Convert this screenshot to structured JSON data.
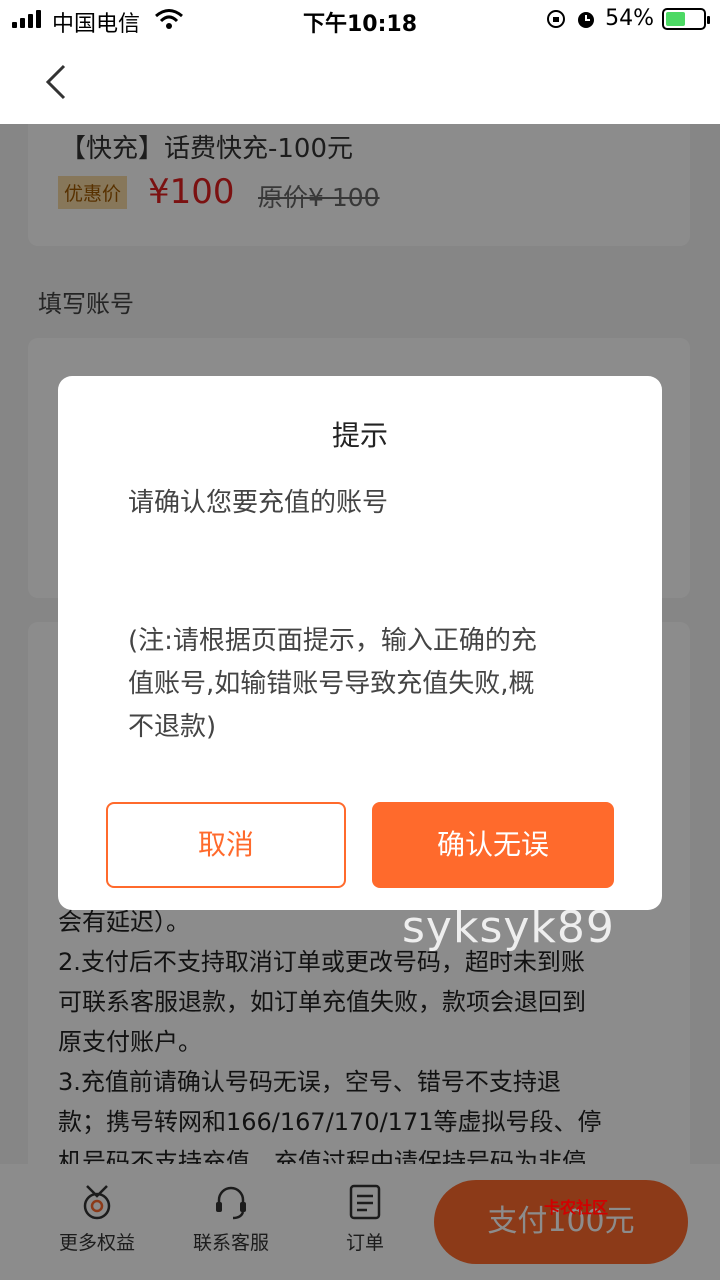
{
  "status_bar": {
    "carrier": "中国电信",
    "time": "下午10:18",
    "battery": "54%",
    "battery_level": 0.54
  },
  "product": {
    "title": "【快充】话费快充-100元",
    "tag": "优惠价",
    "price": "¥100",
    "original_price": "原价¥ 100"
  },
  "account_section": {
    "label": "填写账号"
  },
  "notes": [
    "会有延迟）。",
    "2.支付后不支持取消订单或更改号码，超时未到账",
    "可联系客服退款，如订单充值失败，款项会退回到",
    "原支付账户。",
    "3.充值前请确认号码无误，空号、错号不支持退",
    "款；携号转网和166/167/170/171等虚拟号段、停",
    "机号码不支持充值，充值过程中请保持号码为非停"
  ],
  "dialog": {
    "title": "提示",
    "message": "请确认您要充值的账号",
    "note_lines": [
      "(注:请根据页面提示，输入正确的充",
      "值账号,如输错账号导致充值失败,概",
      "不退款)"
    ],
    "cancel_label": "取消",
    "confirm_label": "确认无误"
  },
  "bottom_bar": {
    "tabs": [
      {
        "label": "更多权益",
        "icon": "medal-icon"
      },
      {
        "label": "联系客服",
        "icon": "headset-icon"
      },
      {
        "label": "订单",
        "icon": "order-list-icon"
      }
    ],
    "pay_label": "支付100元"
  },
  "watermark": "syksyk89",
  "brand_mark": "卡农社区",
  "colors": {
    "accent": "#ff6a2c",
    "price": "#e02020",
    "tag_bg": "#f6d9a4"
  }
}
